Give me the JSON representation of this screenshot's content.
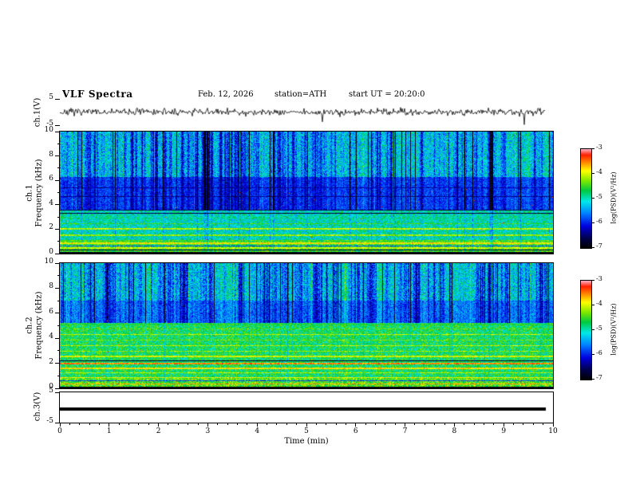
{
  "chart_data": {
    "type": "heatmap",
    "variant": "multi-panel-vlf-spectrogram",
    "title": "VLF Spectra",
    "subtitle": {
      "date": "Feb. 12, 2026",
      "station": "station=ATH",
      "start_ut": "start UT =  20:20:0"
    },
    "xaxis": {
      "label": "Time (min)",
      "lim": [
        0,
        10
      ],
      "ticks": [
        0,
        1,
        2,
        3,
        4,
        5,
        6,
        7,
        8,
        9,
        10
      ],
      "minor_per_major": 5
    },
    "colorbar": {
      "label": "log(PSD)(V²/Hz)",
      "ticks": [
        -3,
        -4,
        -5,
        -6,
        -7
      ],
      "range_top": -3,
      "range_bottom": -7
    },
    "colormap": [
      [
        0.0,
        "#000000"
      ],
      [
        0.1,
        "#00004d"
      ],
      [
        0.22,
        "#0000e0"
      ],
      [
        0.35,
        "#0080ff"
      ],
      [
        0.47,
        "#00e8e8"
      ],
      [
        0.58,
        "#00c840"
      ],
      [
        0.68,
        "#7fe800"
      ],
      [
        0.78,
        "#ffff00"
      ],
      [
        0.87,
        "#ff8000"
      ],
      [
        0.94,
        "#ff2000"
      ],
      [
        1.0,
        "#ffb0c8"
      ]
    ],
    "panels": [
      {
        "type": "line",
        "name": "ch1-voltage",
        "ylabel": "ch.1(V)",
        "ylim": [
          -5,
          5
        ],
        "yticks": [
          5,
          -5
        ],
        "signal": {
          "kind": "random-noise",
          "mean": 0,
          "amplitude_v": 1.1,
          "spike_probability": 0.02,
          "spike_scale": 3,
          "seed": 7
        }
      },
      {
        "type": "heatmap",
        "name": "ch1-spectrogram",
        "ylabel_line1": "ch.1",
        "ylabel_line2": "Frequency (kHz)",
        "ylim": [
          0,
          10
        ],
        "yticks_major": [
          0,
          2,
          4,
          6,
          8,
          10
        ],
        "yticks_minor": [
          1,
          3,
          5,
          7,
          9
        ],
        "psd_range": [
          -7,
          -3
        ],
        "seed": 11,
        "background_regions": [
          {
            "f_min": 0.0,
            "f_max": 1.0,
            "psd": -4.5,
            "psd_noise": 0.45,
            "streak_weight": 0.12
          },
          {
            "f_min": 1.0,
            "f_max": 3.6,
            "psd": -5.0,
            "psd_noise": 0.45,
            "streak_weight": 0.15
          },
          {
            "f_min": 3.6,
            "f_max": 6.3,
            "psd": -5.9,
            "psd_noise": 0.3,
            "streak_weight": 0.5
          },
          {
            "f_min": 6.3,
            "f_max": 10.01,
            "psd": -5.35,
            "psd_noise": 0.5,
            "streak_weight": 0.95
          }
        ],
        "spectral_lines": [
          {
            "f_khz": 0.08,
            "halfwidth_khz": 0.06,
            "psd": -6.95
          },
          {
            "f_khz": 0.3,
            "halfwidth_khz": 0.05,
            "psd": -6.8
          },
          {
            "f_khz": 0.47,
            "halfwidth_khz": 0.05,
            "psd": -4.05
          },
          {
            "f_khz": 0.63,
            "halfwidth_khz": 0.04,
            "psd": -5.8
          },
          {
            "f_khz": 0.84,
            "halfwidth_khz": 0.06,
            "psd": -3.85
          },
          {
            "f_khz": 1.05,
            "halfwidth_khz": 0.05,
            "psd": -4.45
          },
          {
            "f_khz": 1.5,
            "halfwidth_khz": 0.05,
            "psd": -4.2
          },
          {
            "f_khz": 2.0,
            "halfwidth_khz": 0.06,
            "psd": -4.1
          },
          {
            "f_khz": 2.45,
            "halfwidth_khz": 0.05,
            "psd": -4.5
          },
          {
            "f_khz": 2.9,
            "halfwidth_khz": 0.04,
            "psd": -4.8
          },
          {
            "f_khz": 3.3,
            "halfwidth_khz": 0.04,
            "psd": -6.7
          },
          {
            "f_khz": 3.55,
            "halfwidth_khz": 0.04,
            "psd": -6.6
          },
          {
            "f_khz": 4.7,
            "halfwidth_khz": 0.03,
            "psd": -6.4
          },
          {
            "f_khz": 5.4,
            "halfwidth_khz": 0.03,
            "psd": -6.3
          }
        ]
      },
      {
        "type": "heatmap",
        "name": "ch2-spectrogram",
        "ylabel_line1": "ch.2",
        "ylabel_line2": "Frequency (kHz)",
        "ylim": [
          0,
          10
        ],
        "yticks_major": [
          0,
          2,
          4,
          6,
          8,
          10
        ],
        "yticks_minor": [
          1,
          3,
          5,
          7,
          9
        ],
        "psd_range": [
          -7,
          -3
        ],
        "seed": 23,
        "background_regions": [
          {
            "f_min": 0.0,
            "f_max": 0.9,
            "psd": -4.4,
            "psd_noise": 0.45,
            "streak_weight": 0.12
          },
          {
            "f_min": 0.9,
            "f_max": 5.2,
            "psd": -4.7,
            "psd_noise": 0.45,
            "streak_weight": 0.15
          },
          {
            "f_min": 5.2,
            "f_max": 7.0,
            "psd": -5.7,
            "psd_noise": 0.35,
            "streak_weight": 0.6
          },
          {
            "f_min": 7.0,
            "f_max": 10.01,
            "psd": -5.35,
            "psd_noise": 0.5,
            "streak_weight": 0.95
          }
        ],
        "spectral_lines": [
          {
            "f_khz": 0.08,
            "halfwidth_khz": 0.06,
            "psd": -6.95
          },
          {
            "f_khz": 0.35,
            "halfwidth_khz": 0.06,
            "psd": -3.6
          },
          {
            "f_khz": 0.6,
            "halfwidth_khz": 0.04,
            "psd": -5.8
          },
          {
            "f_khz": 0.85,
            "halfwidth_khz": 0.05,
            "psd": -3.9
          },
          {
            "f_khz": 1.25,
            "halfwidth_khz": 0.05,
            "psd": -4.1
          },
          {
            "f_khz": 1.6,
            "halfwidth_khz": 0.05,
            "psd": -3.8
          },
          {
            "f_khz": 2.0,
            "halfwidth_khz": 0.07,
            "psd": -3.5
          },
          {
            "f_khz": 2.22,
            "halfwidth_khz": 0.03,
            "psd": -6.8
          },
          {
            "f_khz": 2.55,
            "halfwidth_khz": 0.05,
            "psd": -4.0
          },
          {
            "f_khz": 2.95,
            "halfwidth_khz": 0.05,
            "psd": -4.2
          },
          {
            "f_khz": 3.4,
            "halfwidth_khz": 0.05,
            "psd": -4.1
          },
          {
            "f_khz": 3.85,
            "halfwidth_khz": 0.05,
            "psd": -4.3
          },
          {
            "f_khz": 4.3,
            "halfwidth_khz": 0.05,
            "psd": -4.1
          },
          {
            "f_khz": 4.75,
            "halfwidth_khz": 0.05,
            "psd": -4.4
          },
          {
            "f_khz": 5.1,
            "halfwidth_khz": 0.04,
            "psd": -4.6
          }
        ]
      },
      {
        "type": "line",
        "name": "ch3-voltage",
        "ylabel": "ch.3(V)",
        "ylim": [
          -5,
          5
        ],
        "yticks": [
          5,
          -5
        ],
        "signal": {
          "kind": "constant",
          "value_v": -0.5,
          "thickness_px": 4
        }
      }
    ]
  }
}
